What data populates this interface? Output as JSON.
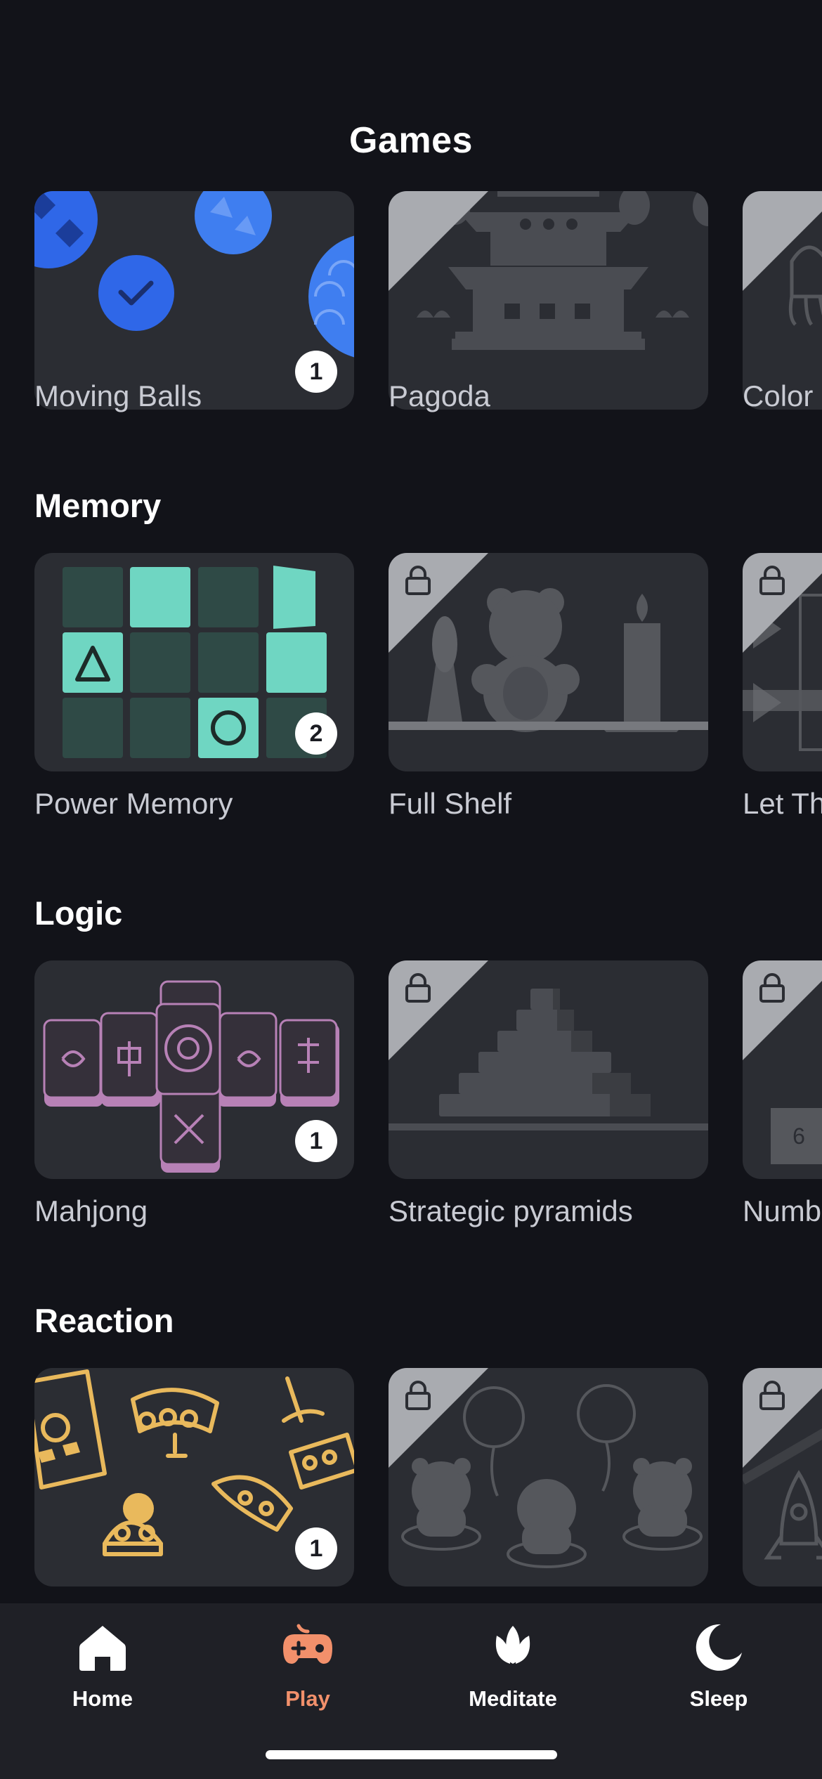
{
  "header": {
    "title": "Games"
  },
  "sections": [
    {
      "title": "",
      "cards": [
        {
          "label": "Moving Balls",
          "badge": "1",
          "locked": false
        },
        {
          "label": "Pagoda",
          "locked": true
        },
        {
          "label": "Color",
          "locked": true
        }
      ]
    },
    {
      "title": "Memory",
      "cards": [
        {
          "label": "Power Memory",
          "badge": "2",
          "locked": false
        },
        {
          "label": "Full Shelf",
          "locked": true
        },
        {
          "label": "Let Th",
          "locked": true
        }
      ]
    },
    {
      "title": "Logic",
      "cards": [
        {
          "label": "Mahjong",
          "badge": "1",
          "locked": false
        },
        {
          "label": "Strategic pyramids",
          "locked": true
        },
        {
          "label": "Numb",
          "locked": true,
          "tile_number": "6"
        }
      ]
    },
    {
      "title": "Reaction",
      "cards": [
        {
          "label": "",
          "badge": "1",
          "locked": false
        },
        {
          "label": "",
          "locked": true
        },
        {
          "label": "",
          "locked": true
        }
      ]
    }
  ],
  "tabbar": {
    "items": [
      {
        "label": "Home",
        "icon": "home-icon",
        "active": false
      },
      {
        "label": "Play",
        "icon": "gamepad-icon",
        "active": true
      },
      {
        "label": "Meditate",
        "icon": "lotus-icon",
        "active": false
      },
      {
        "label": "Sleep",
        "icon": "moon-icon",
        "active": false
      }
    ]
  },
  "colors": {
    "background": "#121319",
    "card": "#2b2d33",
    "accent_active": "#f2906b",
    "memory_teal": "#6fd6c2",
    "mahjong_purple": "#b781b6",
    "reaction_yellow": "#e9b95c",
    "balls_blue": "#2f67e8"
  }
}
